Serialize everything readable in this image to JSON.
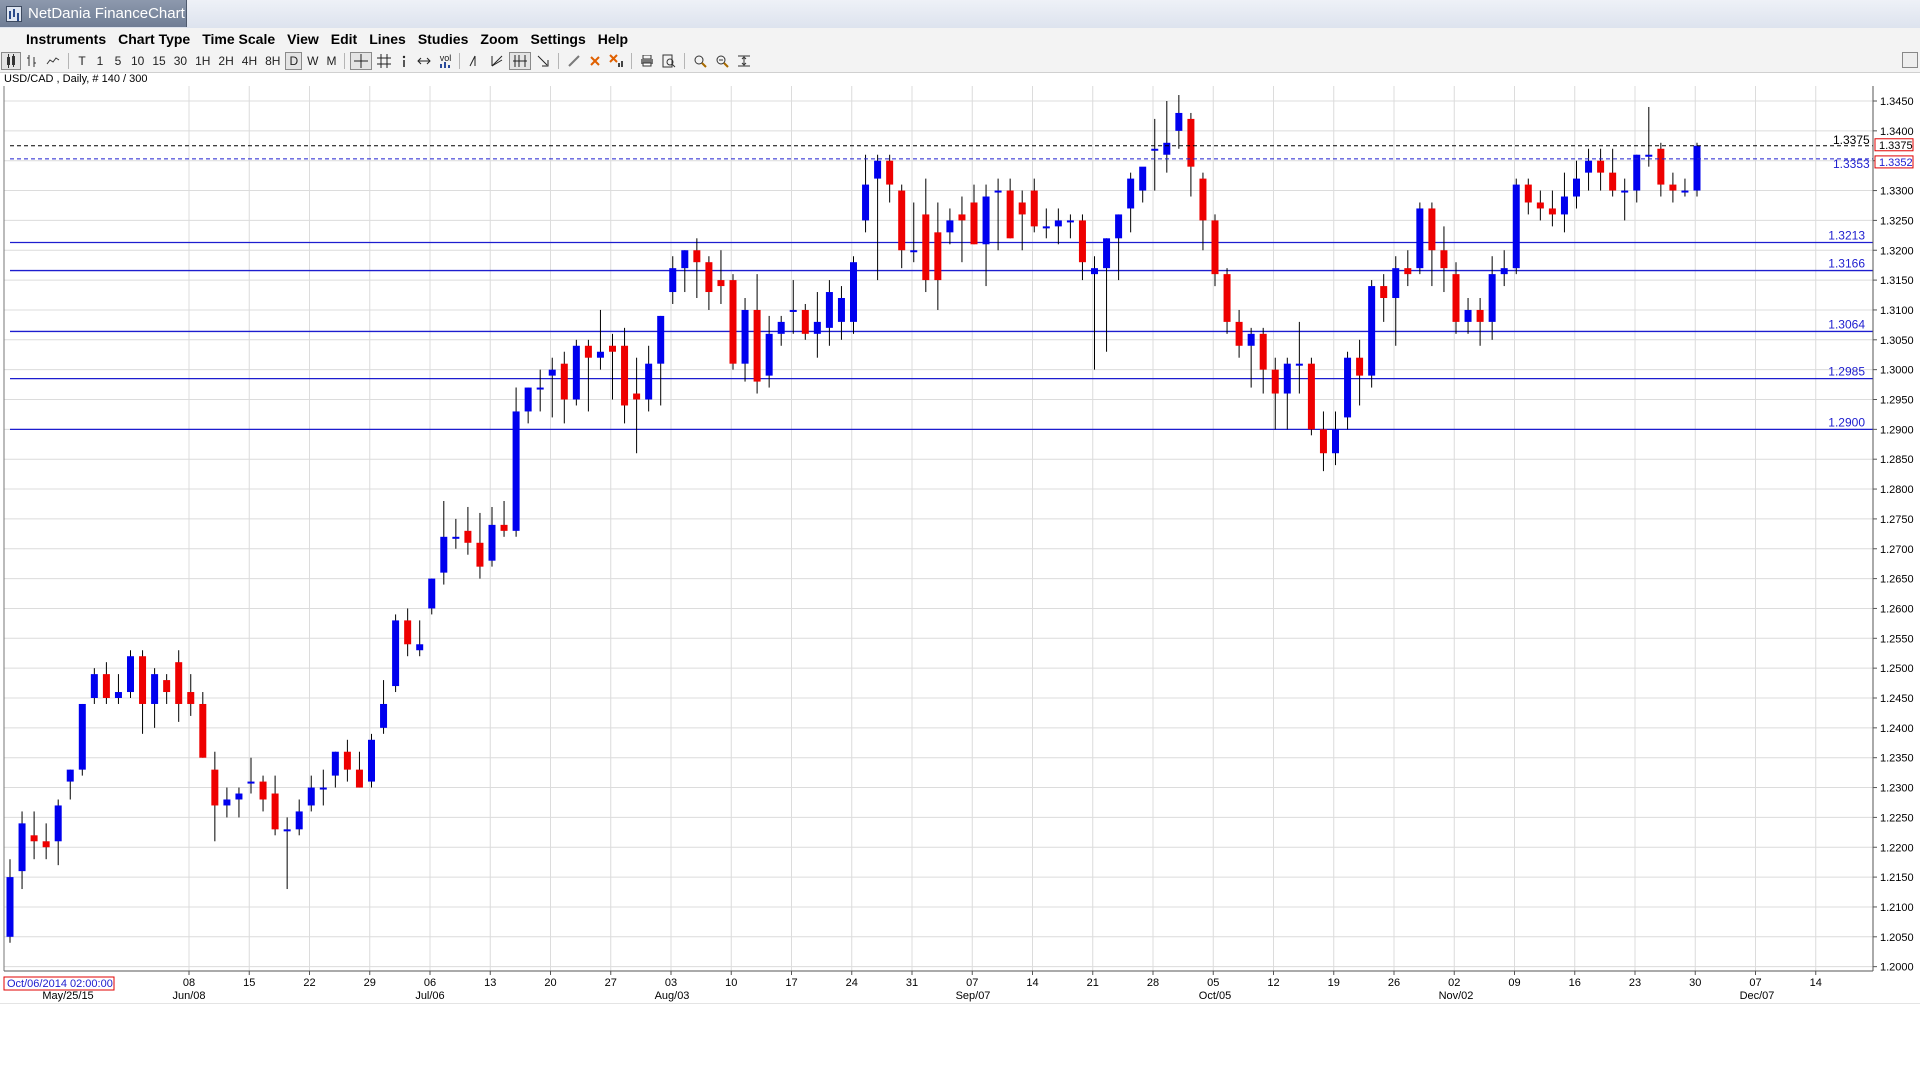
{
  "window": {
    "title": "NetDania FinanceChart"
  },
  "menu": [
    "Instruments",
    "Chart Type",
    "Time Scale",
    "View",
    "Edit",
    "Lines",
    "Studies",
    "Zoom",
    "Settings",
    "Help"
  ],
  "toolbar": {
    "timeframes": [
      "T",
      "1",
      "5",
      "10",
      "15",
      "30",
      "1H",
      "2H",
      "4H",
      "8H",
      "D",
      "W",
      "M"
    ],
    "active_timeframe": "D",
    "icons": [
      "candlestick-icon",
      "bar-chart-icon",
      "line-chart-icon",
      "crosshair-icon",
      "grid-icon",
      "cursor-info-icon",
      "arrows-icon",
      "volume-icon",
      "draw-line-icon",
      "fan-icon",
      "fibonacci-icon",
      "trend-arrow-icon",
      "pencil-icon",
      "delete-icon",
      "delete-all-icon",
      "print-icon",
      "preview-icon",
      "zoom-in-icon",
      "zoom-out-icon",
      "fit-icon"
    ],
    "vol_label": "vol"
  },
  "instrument_info": "USD/CAD , Daily, # 140 / 300",
  "colors": {
    "up": "#0000ee",
    "down": "#ee0000",
    "level_line": "#1d1dcf",
    "grid": "#dcdcdc"
  },
  "chart_data": {
    "type": "candlestick",
    "instrument": "USD/CAD",
    "interval": "Daily",
    "ylim": [
      1.2,
      1.35
    ],
    "y_ticks": [
      "1.3450",
      "1.3400",
      "1.3350",
      "1.3300",
      "1.3250",
      "1.3200",
      "1.3150",
      "1.3100",
      "1.3050",
      "1.3000",
      "1.2950",
      "1.2900",
      "1.2850",
      "1.2800",
      "1.2750",
      "1.2700",
      "1.2650",
      "1.2600",
      "1.2550",
      "1.2500",
      "1.2450",
      "1.2400",
      "1.2350",
      "1.2300",
      "1.2250",
      "1.2200",
      "1.2150",
      "1.2100",
      "1.2050",
      "1.2000"
    ],
    "x_tick_labels": [
      "08",
      "15",
      "22",
      "29",
      "06",
      "13",
      "20",
      "27",
      "03",
      "10",
      "17",
      "24",
      "31",
      "07",
      "14",
      "21",
      "28",
      "05",
      "12",
      "19",
      "26",
      "02",
      "09",
      "16",
      "23",
      "30",
      "07",
      "14"
    ],
    "x_month_labels": [
      "May/25/15",
      "Jun/08",
      "Jul/06",
      "Aug/03",
      "Sep/07",
      "Oct/05",
      "Nov/02",
      "Dec/07"
    ],
    "x_start_label": "Oct/06/2014 02:00:00",
    "levels": [
      1.3213,
      1.3166,
      1.3064,
      1.2985,
      1.29
    ],
    "level_labels": [
      "1.3213",
      "1.3166",
      "1.3064",
      "1.2985",
      "1.2900"
    ],
    "price_lines": {
      "close": "1.3375",
      "prev_close": "1.3353"
    },
    "price_box_labels": [
      "1.3375",
      "1.3352"
    ],
    "candles": [
      {
        "o": 1.205,
        "h": 1.218,
        "l": 1.204,
        "c": 1.215
      },
      {
        "o": 1.216,
        "h": 1.226,
        "l": 1.213,
        "c": 1.224
      },
      {
        "o": 1.222,
        "h": 1.226,
        "l": 1.218,
        "c": 1.221
      },
      {
        "o": 1.221,
        "h": 1.224,
        "l": 1.218,
        "c": 1.22
      },
      {
        "o": 1.221,
        "h": 1.228,
        "l": 1.217,
        "c": 1.227
      },
      {
        "o": 1.231,
        "h": 1.233,
        "l": 1.228,
        "c": 1.233
      },
      {
        "o": 1.233,
        "h": 1.244,
        "l": 1.232,
        "c": 1.244
      },
      {
        "o": 1.245,
        "h": 1.25,
        "l": 1.244,
        "c": 1.249
      },
      {
        "o": 1.249,
        "h": 1.251,
        "l": 1.244,
        "c": 1.245
      },
      {
        "o": 1.245,
        "h": 1.249,
        "l": 1.244,
        "c": 1.246
      },
      {
        "o": 1.246,
        "h": 1.253,
        "l": 1.245,
        "c": 1.252
      },
      {
        "o": 1.252,
        "h": 1.253,
        "l": 1.239,
        "c": 1.244
      },
      {
        "o": 1.244,
        "h": 1.25,
        "l": 1.24,
        "c": 1.249
      },
      {
        "o": 1.248,
        "h": 1.249,
        "l": 1.244,
        "c": 1.246
      },
      {
        "o": 1.251,
        "h": 1.253,
        "l": 1.241,
        "c": 1.244
      },
      {
        "o": 1.246,
        "h": 1.249,
        "l": 1.242,
        "c": 1.244
      },
      {
        "o": 1.244,
        "h": 1.246,
        "l": 1.235,
        "c": 1.235
      },
      {
        "o": 1.233,
        "h": 1.236,
        "l": 1.221,
        "c": 1.227
      },
      {
        "o": 1.227,
        "h": 1.23,
        "l": 1.225,
        "c": 1.228
      },
      {
        "o": 1.228,
        "h": 1.23,
        "l": 1.225,
        "c": 1.229
      },
      {
        "o": 1.231,
        "h": 1.235,
        "l": 1.229,
        "c": 1.231
      },
      {
        "o": 1.231,
        "h": 1.232,
        "l": 1.226,
        "c": 1.228
      },
      {
        "o": 1.229,
        "h": 1.232,
        "l": 1.222,
        "c": 1.223
      },
      {
        "o": 1.223,
        "h": 1.225,
        "l": 1.213,
        "c": 1.223
      },
      {
        "o": 1.223,
        "h": 1.228,
        "l": 1.222,
        "c": 1.226
      },
      {
        "o": 1.227,
        "h": 1.232,
        "l": 1.226,
        "c": 1.23
      },
      {
        "o": 1.23,
        "h": 1.233,
        "l": 1.227,
        "c": 1.23
      },
      {
        "o": 1.232,
        "h": 1.236,
        "l": 1.23,
        "c": 1.236
      },
      {
        "o": 1.236,
        "h": 1.238,
        "l": 1.231,
        "c": 1.233
      },
      {
        "o": 1.233,
        "h": 1.236,
        "l": 1.23,
        "c": 1.23
      },
      {
        "o": 1.231,
        "h": 1.239,
        "l": 1.23,
        "c": 1.238
      },
      {
        "o": 1.24,
        "h": 1.248,
        "l": 1.239,
        "c": 1.244
      },
      {
        "o": 1.247,
        "h": 1.259,
        "l": 1.246,
        "c": 1.258
      },
      {
        "o": 1.258,
        "h": 1.26,
        "l": 1.252,
        "c": 1.254
      },
      {
        "o": 1.253,
        "h": 1.258,
        "l": 1.252,
        "c": 1.254
      },
      {
        "o": 1.26,
        "h": 1.265,
        "l": 1.259,
        "c": 1.265
      },
      {
        "o": 1.266,
        "h": 1.278,
        "l": 1.264,
        "c": 1.272
      },
      {
        "o": 1.272,
        "h": 1.275,
        "l": 1.27,
        "c": 1.272
      },
      {
        "o": 1.273,
        "h": 1.277,
        "l": 1.269,
        "c": 1.271
      },
      {
        "o": 1.271,
        "h": 1.276,
        "l": 1.265,
        "c": 1.267
      },
      {
        "o": 1.268,
        "h": 1.277,
        "l": 1.267,
        "c": 1.274
      },
      {
        "o": 1.274,
        "h": 1.278,
        "l": 1.272,
        "c": 1.273
      },
      {
        "o": 1.273,
        "h": 1.297,
        "l": 1.272,
        "c": 1.293
      },
      {
        "o": 1.293,
        "h": 1.297,
        "l": 1.291,
        "c": 1.297
      },
      {
        "o": 1.297,
        "h": 1.3,
        "l": 1.293,
        "c": 1.297
      },
      {
        "o": 1.299,
        "h": 1.302,
        "l": 1.292,
        "c": 1.3
      },
      {
        "o": 1.301,
        "h": 1.303,
        "l": 1.291,
        "c": 1.295
      },
      {
        "o": 1.295,
        "h": 1.305,
        "l": 1.294,
        "c": 1.304
      },
      {
        "o": 1.304,
        "h": 1.305,
        "l": 1.293,
        "c": 1.302
      },
      {
        "o": 1.302,
        "h": 1.31,
        "l": 1.3,
        "c": 1.303
      },
      {
        "o": 1.304,
        "h": 1.306,
        "l": 1.295,
        "c": 1.303
      },
      {
        "o": 1.304,
        "h": 1.307,
        "l": 1.291,
        "c": 1.294
      },
      {
        "o": 1.296,
        "h": 1.302,
        "l": 1.286,
        "c": 1.295
      },
      {
        "o": 1.295,
        "h": 1.304,
        "l": 1.293,
        "c": 1.301
      },
      {
        "o": 1.301,
        "h": 1.309,
        "l": 1.294,
        "c": 1.309
      },
      {
        "o": 1.313,
        "h": 1.319,
        "l": 1.311,
        "c": 1.317
      },
      {
        "o": 1.317,
        "h": 1.32,
        "l": 1.313,
        "c": 1.32
      },
      {
        "o": 1.32,
        "h": 1.322,
        "l": 1.312,
        "c": 1.318
      },
      {
        "o": 1.318,
        "h": 1.319,
        "l": 1.31,
        "c": 1.313
      },
      {
        "o": 1.315,
        "h": 1.32,
        "l": 1.311,
        "c": 1.314
      },
      {
        "o": 1.315,
        "h": 1.316,
        "l": 1.3,
        "c": 1.301
      },
      {
        "o": 1.301,
        "h": 1.312,
        "l": 1.298,
        "c": 1.31
      },
      {
        "o": 1.31,
        "h": 1.316,
        "l": 1.296,
        "c": 1.298
      },
      {
        "o": 1.299,
        "h": 1.309,
        "l": 1.297,
        "c": 1.306
      },
      {
        "o": 1.306,
        "h": 1.309,
        "l": 1.304,
        "c": 1.308
      },
      {
        "o": 1.31,
        "h": 1.315,
        "l": 1.306,
        "c": 1.31
      },
      {
        "o": 1.31,
        "h": 1.311,
        "l": 1.305,
        "c": 1.306
      },
      {
        "o": 1.306,
        "h": 1.313,
        "l": 1.302,
        "c": 1.308
      },
      {
        "o": 1.307,
        "h": 1.315,
        "l": 1.304,
        "c": 1.313
      },
      {
        "o": 1.308,
        "h": 1.314,
        "l": 1.305,
        "c": 1.312
      },
      {
        "o": 1.308,
        "h": 1.319,
        "l": 1.306,
        "c": 1.318
      },
      {
        "o": 1.325,
        "h": 1.336,
        "l": 1.323,
        "c": 1.331
      },
      {
        "o": 1.332,
        "h": 1.336,
        "l": 1.315,
        "c": 1.335
      },
      {
        "o": 1.335,
        "h": 1.336,
        "l": 1.328,
        "c": 1.331
      },
      {
        "o": 1.33,
        "h": 1.331,
        "l": 1.317,
        "c": 1.32
      },
      {
        "o": 1.32,
        "h": 1.328,
        "l": 1.318,
        "c": 1.32
      },
      {
        "o": 1.326,
        "h": 1.332,
        "l": 1.313,
        "c": 1.315
      },
      {
        "o": 1.323,
        "h": 1.328,
        "l": 1.31,
        "c": 1.315
      },
      {
        "o": 1.323,
        "h": 1.327,
        "l": 1.321,
        "c": 1.325
      },
      {
        "o": 1.326,
        "h": 1.329,
        "l": 1.318,
        "c": 1.325
      },
      {
        "o": 1.328,
        "h": 1.331,
        "l": 1.321,
        "c": 1.321
      },
      {
        "o": 1.321,
        "h": 1.331,
        "l": 1.314,
        "c": 1.329
      },
      {
        "o": 1.33,
        "h": 1.332,
        "l": 1.32,
        "c": 1.33
      },
      {
        "o": 1.33,
        "h": 1.332,
        "l": 1.322,
        "c": 1.322
      },
      {
        "o": 1.328,
        "h": 1.33,
        "l": 1.32,
        "c": 1.326
      },
      {
        "o": 1.33,
        "h": 1.332,
        "l": 1.323,
        "c": 1.324
      },
      {
        "o": 1.324,
        "h": 1.327,
        "l": 1.322,
        "c": 1.324
      },
      {
        "o": 1.324,
        "h": 1.327,
        "l": 1.321,
        "c": 1.325
      },
      {
        "o": 1.325,
        "h": 1.326,
        "l": 1.322,
        "c": 1.325
      },
      {
        "o": 1.325,
        "h": 1.326,
        "l": 1.315,
        "c": 1.318
      },
      {
        "o": 1.316,
        "h": 1.319,
        "l": 1.3,
        "c": 1.317
      },
      {
        "o": 1.317,
        "h": 1.322,
        "l": 1.303,
        "c": 1.322
      },
      {
        "o": 1.322,
        "h": 1.326,
        "l": 1.315,
        "c": 1.326
      },
      {
        "o": 1.327,
        "h": 1.333,
        "l": 1.323,
        "c": 1.332
      },
      {
        "o": 1.33,
        "h": 1.333,
        "l": 1.328,
        "c": 1.334
      },
      {
        "o": 1.337,
        "h": 1.342,
        "l": 1.33,
        "c": 1.337
      },
      {
        "o": 1.336,
        "h": 1.345,
        "l": 1.333,
        "c": 1.338
      },
      {
        "o": 1.34,
        "h": 1.346,
        "l": 1.337,
        "c": 1.343
      },
      {
        "o": 1.342,
        "h": 1.343,
        "l": 1.329,
        "c": 1.334
      },
      {
        "o": 1.332,
        "h": 1.333,
        "l": 1.32,
        "c": 1.325
      },
      {
        "o": 1.325,
        "h": 1.326,
        "l": 1.314,
        "c": 1.316
      },
      {
        "o": 1.316,
        "h": 1.317,
        "l": 1.306,
        "c": 1.308
      },
      {
        "o": 1.308,
        "h": 1.31,
        "l": 1.302,
        "c": 1.304
      },
      {
        "o": 1.304,
        "h": 1.307,
        "l": 1.297,
        "c": 1.306
      },
      {
        "o": 1.306,
        "h": 1.307,
        "l": 1.296,
        "c": 1.3
      },
      {
        "o": 1.3,
        "h": 1.302,
        "l": 1.29,
        "c": 1.296
      },
      {
        "o": 1.296,
        "h": 1.302,
        "l": 1.29,
        "c": 1.301
      },
      {
        "o": 1.301,
        "h": 1.308,
        "l": 1.296,
        "c": 1.301
      },
      {
        "o": 1.301,
        "h": 1.302,
        "l": 1.289,
        "c": 1.29
      },
      {
        "o": 1.29,
        "h": 1.293,
        "l": 1.283,
        "c": 1.286
      },
      {
        "o": 1.286,
        "h": 1.293,
        "l": 1.284,
        "c": 1.29
      },
      {
        "o": 1.292,
        "h": 1.303,
        "l": 1.29,
        "c": 1.302
      },
      {
        "o": 1.302,
        "h": 1.305,
        "l": 1.294,
        "c": 1.299
      },
      {
        "o": 1.299,
        "h": 1.315,
        "l": 1.297,
        "c": 1.314
      },
      {
        "o": 1.314,
        "h": 1.316,
        "l": 1.308,
        "c": 1.312
      },
      {
        "o": 1.312,
        "h": 1.319,
        "l": 1.304,
        "c": 1.317
      },
      {
        "o": 1.317,
        "h": 1.32,
        "l": 1.314,
        "c": 1.316
      },
      {
        "o": 1.317,
        "h": 1.328,
        "l": 1.316,
        "c": 1.327
      },
      {
        "o": 1.327,
        "h": 1.328,
        "l": 1.314,
        "c": 1.32
      },
      {
        "o": 1.32,
        "h": 1.324,
        "l": 1.313,
        "c": 1.317
      },
      {
        "o": 1.316,
        "h": 1.318,
        "l": 1.306,
        "c": 1.308
      },
      {
        "o": 1.308,
        "h": 1.312,
        "l": 1.306,
        "c": 1.31
      },
      {
        "o": 1.31,
        "h": 1.312,
        "l": 1.304,
        "c": 1.308
      },
      {
        "o": 1.308,
        "h": 1.319,
        "l": 1.305,
        "c": 1.316
      },
      {
        "o": 1.316,
        "h": 1.32,
        "l": 1.314,
        "c": 1.317
      },
      {
        "o": 1.317,
        "h": 1.332,
        "l": 1.316,
        "c": 1.331
      },
      {
        "o": 1.331,
        "h": 1.332,
        "l": 1.326,
        "c": 1.328
      },
      {
        "o": 1.328,
        "h": 1.33,
        "l": 1.325,
        "c": 1.327
      },
      {
        "o": 1.327,
        "h": 1.33,
        "l": 1.324,
        "c": 1.326
      },
      {
        "o": 1.326,
        "h": 1.333,
        "l": 1.323,
        "c": 1.329
      },
      {
        "o": 1.329,
        "h": 1.335,
        "l": 1.327,
        "c": 1.332
      },
      {
        "o": 1.333,
        "h": 1.337,
        "l": 1.33,
        "c": 1.335
      },
      {
        "o": 1.335,
        "h": 1.337,
        "l": 1.33,
        "c": 1.333
      },
      {
        "o": 1.333,
        "h": 1.337,
        "l": 1.329,
        "c": 1.33
      },
      {
        "o": 1.33,
        "h": 1.332,
        "l": 1.325,
        "c": 1.33
      },
      {
        "o": 1.33,
        "h": 1.336,
        "l": 1.328,
        "c": 1.336
      },
      {
        "o": 1.336,
        "h": 1.344,
        "l": 1.334,
        "c": 1.336
      },
      {
        "o": 1.337,
        "h": 1.338,
        "l": 1.329,
        "c": 1.331
      },
      {
        "o": 1.331,
        "h": 1.333,
        "l": 1.328,
        "c": 1.33
      },
      {
        "o": 1.33,
        "h": 1.332,
        "l": 1.329,
        "c": 1.33
      },
      {
        "o": 1.33,
        "h": 1.338,
        "l": 1.329,
        "c": 1.3375
      }
    ]
  }
}
